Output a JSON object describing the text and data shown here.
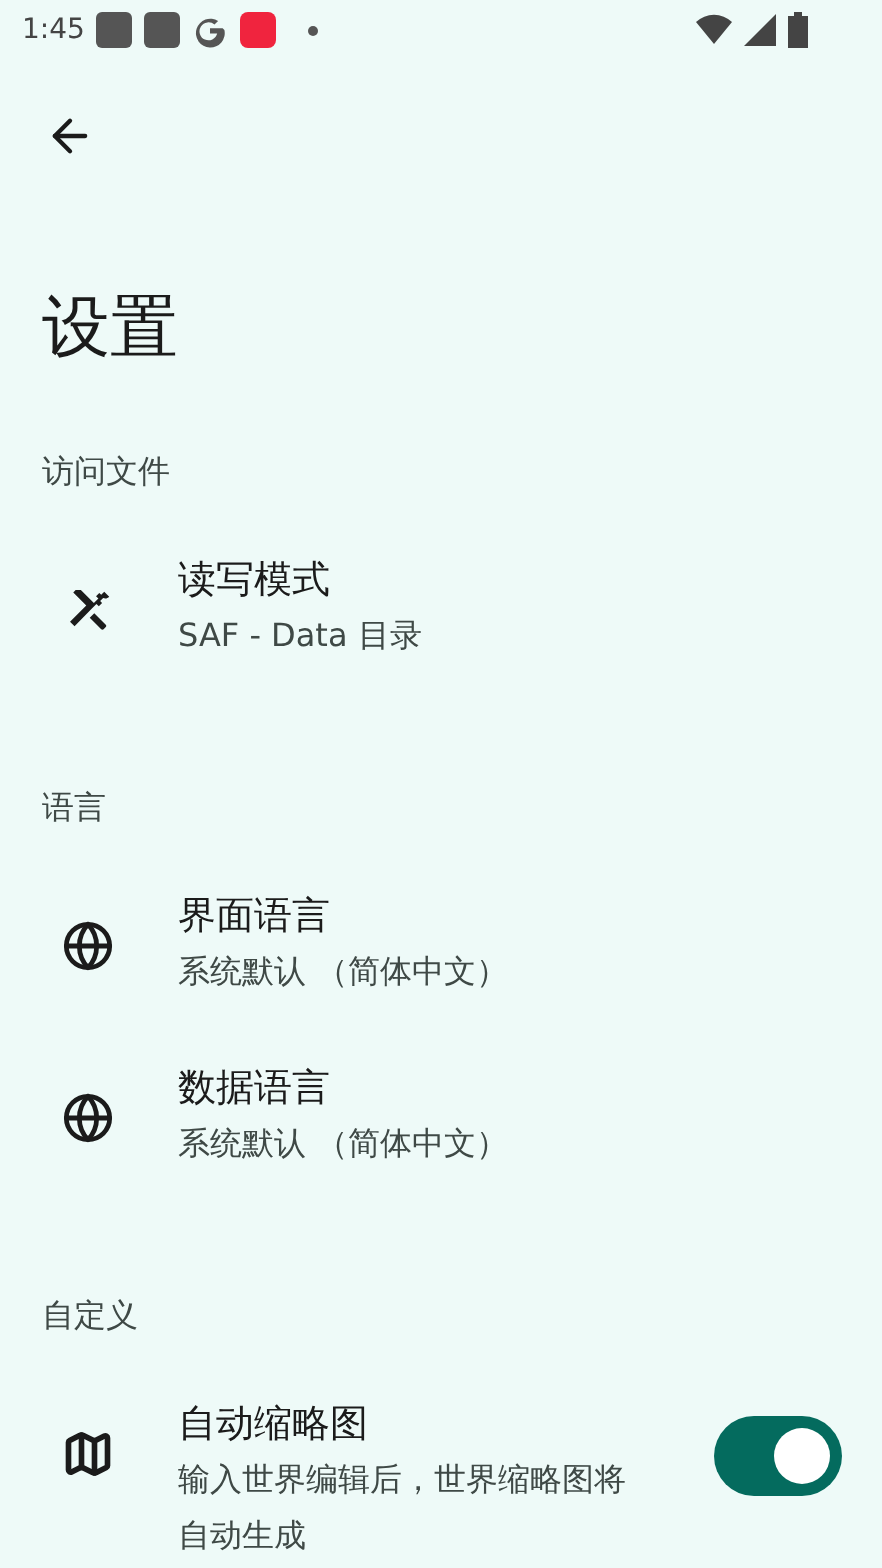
{
  "status_bar": {
    "time": "1:45"
  },
  "title": "设置",
  "sections": [
    {
      "header": "访问文件",
      "items": [
        {
          "kind": "tools",
          "title": "读写模式",
          "subtitle": "SAF - Data 目录"
        }
      ]
    },
    {
      "header": "语言",
      "items": [
        {
          "kind": "globe",
          "title": "界面语言",
          "subtitle": "系统默认 （简体中文）"
        },
        {
          "kind": "globe",
          "title": "数据语言",
          "subtitle": "系统默认 （简体中文）"
        }
      ]
    },
    {
      "header": "自定义",
      "items": [
        {
          "kind": "map",
          "title": "自动缩略图",
          "subtitle": "输入世界编辑后，世界缩略图将自动生成",
          "on": true
        }
      ]
    }
  ]
}
